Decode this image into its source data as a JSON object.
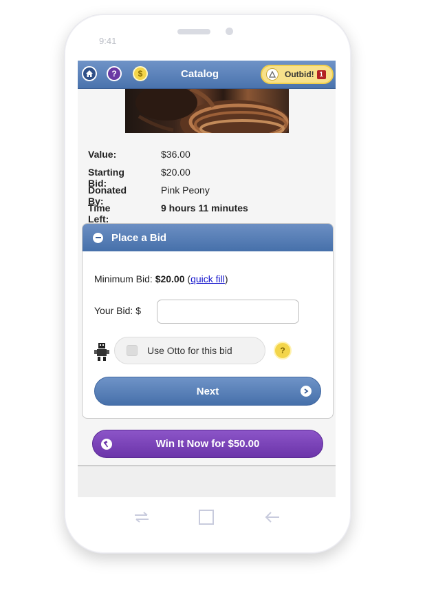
{
  "status_bar": {
    "time": "9:41"
  },
  "header": {
    "title": "Catalog",
    "home_icon": "home-icon",
    "help_label": "?",
    "money_label": "$",
    "outbid": {
      "label": "Outbid!",
      "count": "1"
    }
  },
  "item": {
    "details": [
      {
        "label": "Value:",
        "value": "$36.00"
      },
      {
        "label": "Starting Bid:",
        "value": "$20.00"
      },
      {
        "label": "Donated By:",
        "value": "Pink Peony"
      },
      {
        "label": "Time Left:",
        "value": "9 hours 11 minutes"
      }
    ]
  },
  "bid_panel": {
    "title": "Place a Bid",
    "minimum_bid_label": "Minimum Bid:",
    "minimum_bid_value": "$20.00",
    "quick_fill_link": "quick fill",
    "your_bid_label": "Your Bid: $",
    "your_bid_value": "",
    "otto_label": "Use Otto for this bid",
    "otto_help": "?",
    "next_label": "Next"
  },
  "win_now": {
    "label": "Win It Now for $50.00"
  },
  "colors": {
    "header_blue": "#4a73ad",
    "purple": "#6b34a9",
    "gold": "#f3d54a",
    "alert_red": "#b32222",
    "link_blue": "#1515cc"
  }
}
